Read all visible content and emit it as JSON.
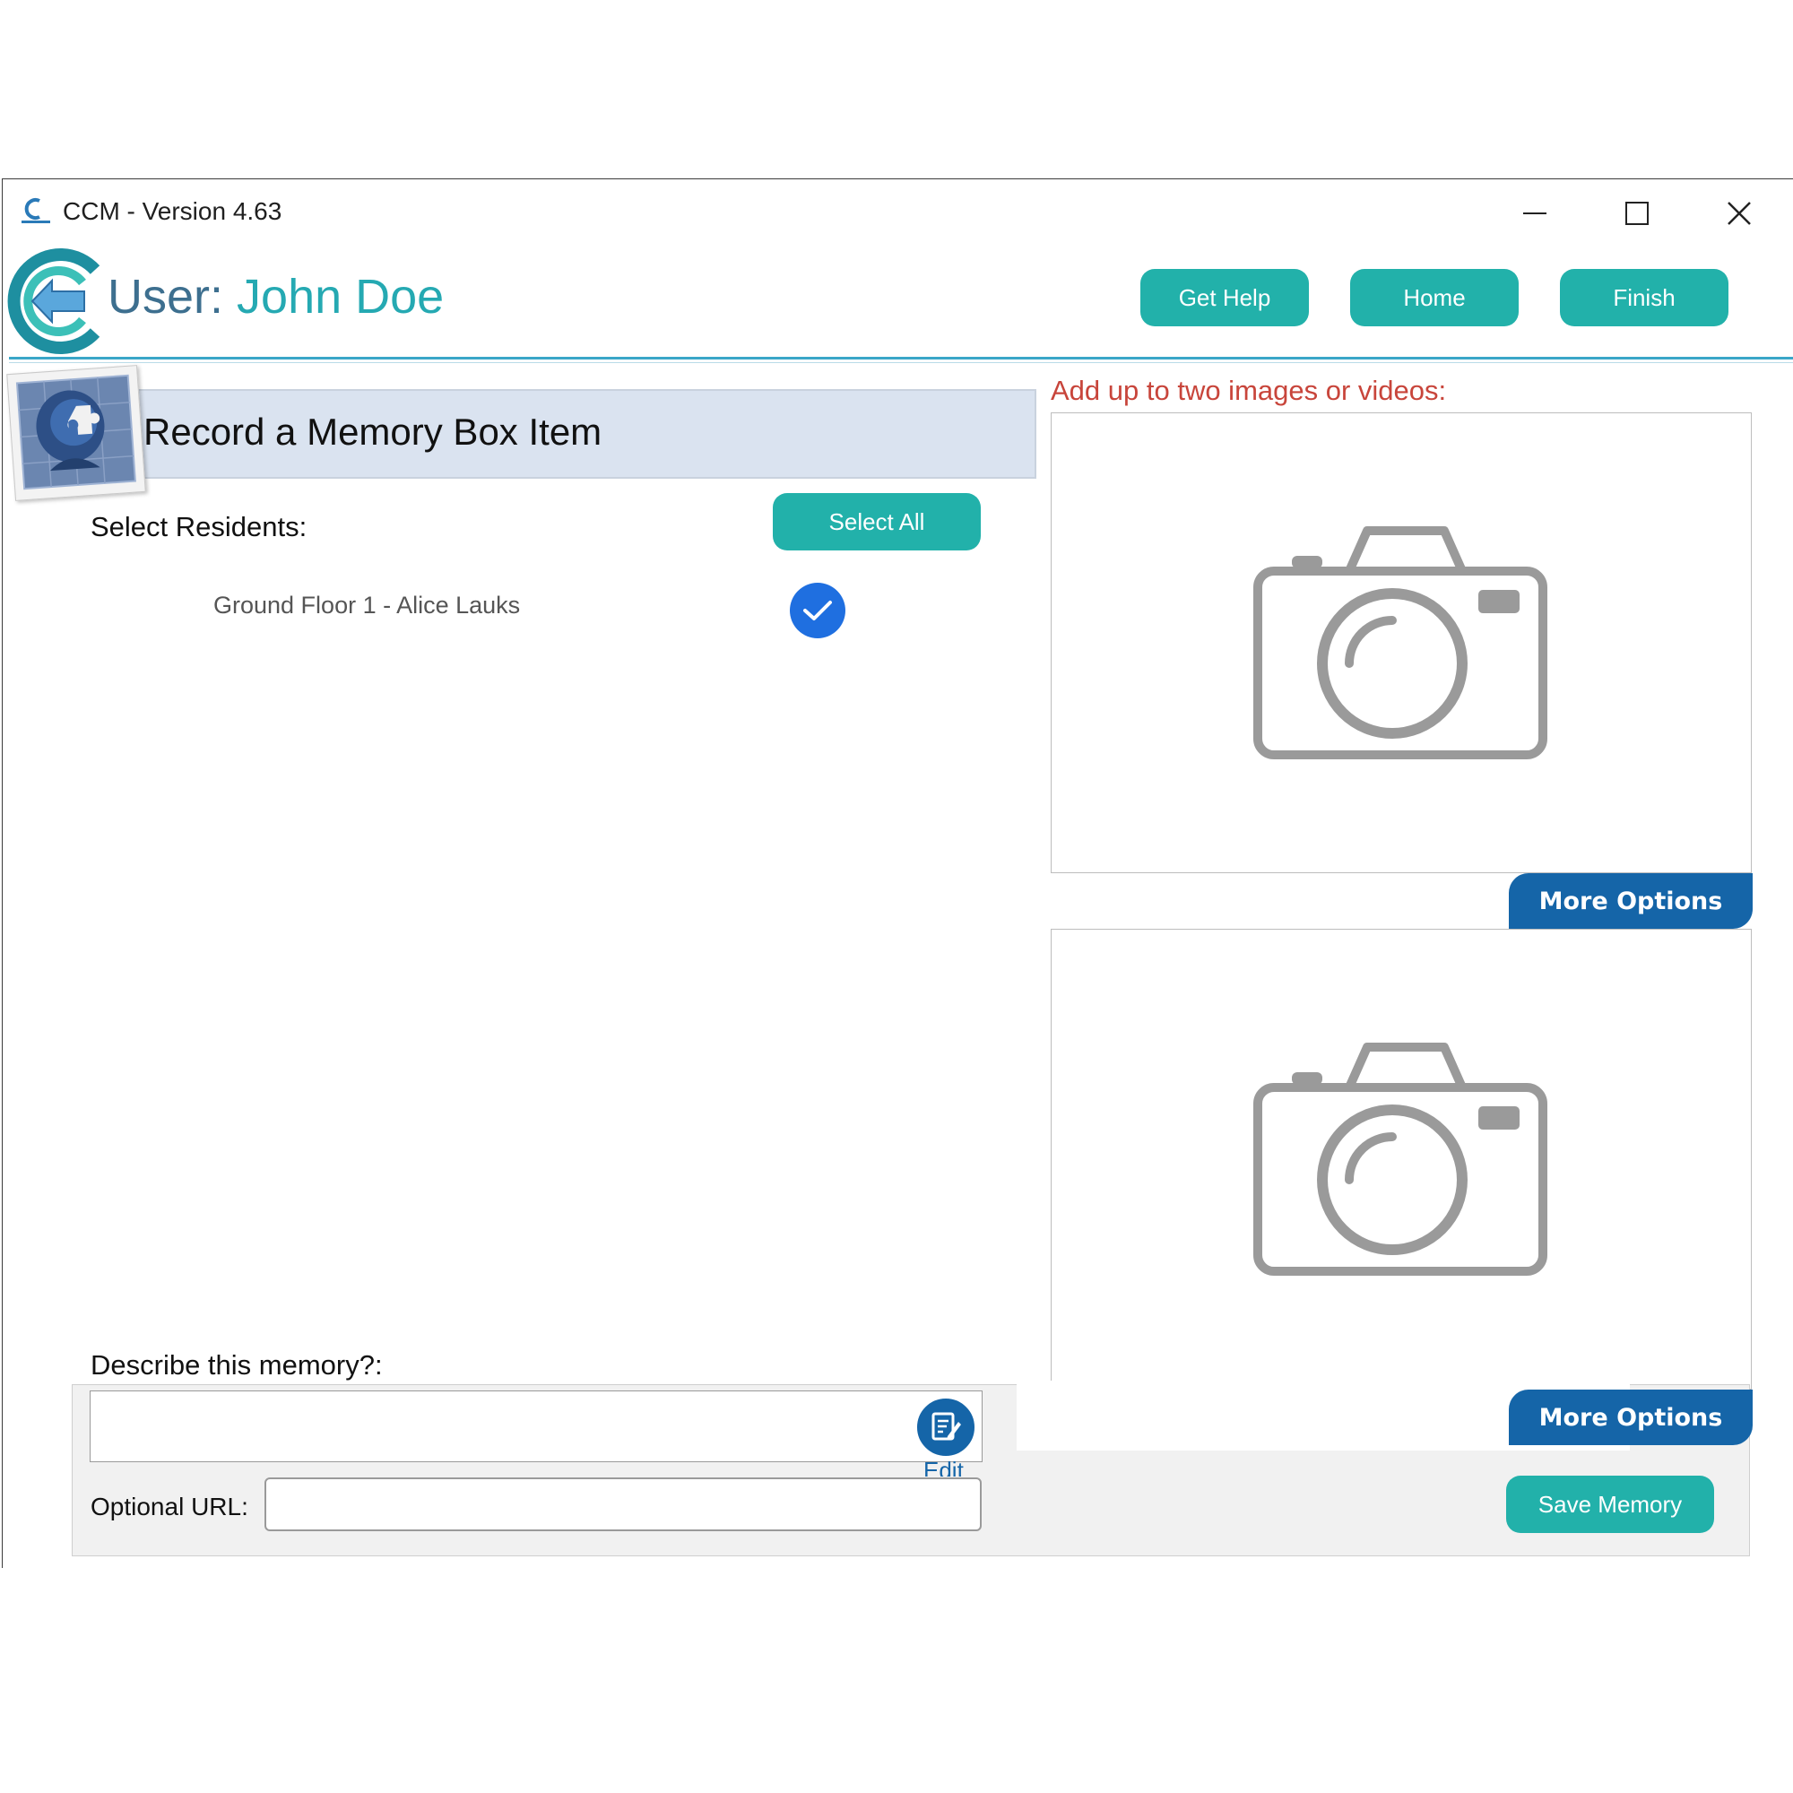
{
  "window": {
    "title": "CCM - Version 4.63",
    "controls": [
      "minimize-icon",
      "maximize-icon",
      "close-icon"
    ]
  },
  "header": {
    "user_prefix": "User:",
    "user_name": "John Doe",
    "buttons": {
      "help": "Get Help",
      "home": "Home",
      "finish": "Finish"
    }
  },
  "section": {
    "title": "Record a Memory Box Item"
  },
  "residents": {
    "label": "Select Residents:",
    "select_all": "Select All",
    "items": [
      {
        "name": "Ground Floor 1 - Alice Lauks",
        "checked": true
      }
    ]
  },
  "media": {
    "label": "Add up to two images or videos:",
    "slots": [
      {
        "icon": "camera-icon",
        "more_options": "More Options"
      },
      {
        "icon": "camera-icon",
        "more_options": "More Options"
      }
    ]
  },
  "form": {
    "describe_label": "Describe this memory?:",
    "describe_value": "",
    "edit_label": "Edit",
    "url_label": "Optional URL:",
    "url_value": "",
    "save_button": "Save Memory"
  },
  "colors": {
    "teal": "#22b1aa",
    "blue": "#1565a8",
    "check_blue": "#1f6fe0",
    "label_red": "#c8453b",
    "banner": "#dae3f0"
  }
}
